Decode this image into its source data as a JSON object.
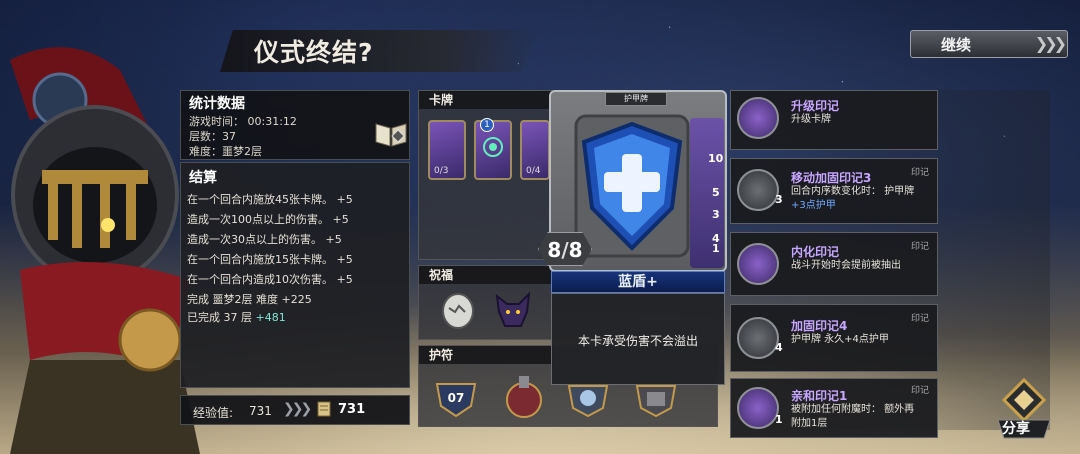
{
  "screen_title": "仪式终结?",
  "continue_label": "继续",
  "stats": {
    "title": "统计数据",
    "lines": [
      "游戏时间： 00:31:12",
      "层数：37",
      "难度：噩梦2层"
    ]
  },
  "settlement": {
    "title": "结算",
    "lines": [
      "在一个回合内施放45张卡牌。 +5",
      "造成一次100点以上的伤害。 +5",
      "造成一次30点以上的伤害。 +5",
      "在一个回合内施放15张卡牌。 +5",
      "在一个回合内造成10次伤害。 +5",
      "完成 噩梦2层 难度 +225"
    ],
    "last_line_prefix": "已完成 37 层",
    "last_line_bonus": "+481"
  },
  "experience": {
    "label": "经验值:",
    "value": "731",
    "total": "731"
  },
  "sections": {
    "cards": "卡牌",
    "blessings": "祝福",
    "amulets": "护符"
  },
  "mini_cards": [
    {
      "count": "0/3",
      "badge": ""
    },
    {
      "count": "",
      "badge": "1"
    },
    {
      "count": "0/4",
      "badge": ""
    }
  ],
  "amulet_badge": "07",
  "focused_card": {
    "type_label": "护甲牌",
    "cost": "8",
    "cost_max": "8",
    "name": "蓝盾+",
    "description": "本卡承受伤害不会溢出",
    "side_numbers": [
      "10",
      "5",
      "3",
      "4",
      "1"
    ]
  },
  "seals": [
    {
      "name": "升级印记",
      "tag": "",
      "level": "",
      "desc_lines": [
        "升级卡牌"
      ]
    },
    {
      "name": "移动加固印记3",
      "tag": "印记",
      "level": "3",
      "desc_lines": [
        "回合内序数变化时：  护甲牌",
        "+3点护甲"
      ]
    },
    {
      "name": "内化印记",
      "tag": "印记",
      "level": "",
      "desc_lines": [
        "战斗开始时会提前被抽出"
      ]
    },
    {
      "name": "加固印记4",
      "tag": "印记",
      "level": "4",
      "desc_lines": [
        "护甲牌 永久+4点护甲"
      ]
    },
    {
      "name": "亲和印记1",
      "tag": "印记",
      "level": "1",
      "desc_lines": [
        "被附加任何附魔时：  额外再",
        "附加1层"
      ]
    }
  ],
  "share_label": "分享",
  "colors": {
    "accent_teal": "#7fe6d4",
    "seal_name_purple": "#c6a6ff",
    "card_name_blue": "#16347a"
  }
}
